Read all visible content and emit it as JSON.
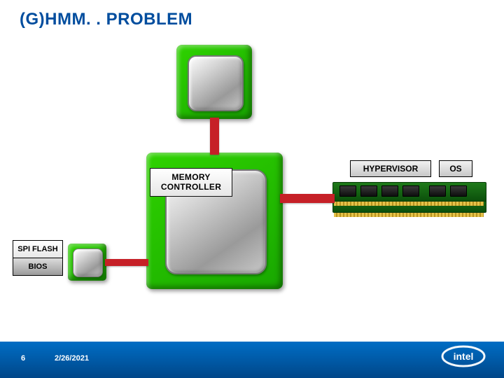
{
  "title": "(G)HMM. . PROBLEM",
  "labels": {
    "memory_controller_l1": "MEMORY",
    "memory_controller_l2": "CONTROLLER",
    "spi_flash": "SPI FLASH",
    "bios": "BIOS",
    "hypervisor": "HYPERVISOR",
    "os": "OS"
  },
  "footer": {
    "slide_number": "6",
    "date": "2/26/2021",
    "logo_text": "intel"
  },
  "diagram": {
    "nodes": [
      {
        "id": "cpu-small",
        "role": "processor-small"
      },
      {
        "id": "chipset",
        "role": "chipset-large",
        "attached_label": "memory-controller"
      },
      {
        "id": "spi-chip",
        "role": "spi-flash-chip"
      },
      {
        "id": "ram-module-1",
        "role": "dimm"
      },
      {
        "id": "ram-module-2",
        "role": "dimm"
      }
    ],
    "edges": [
      {
        "from": "cpu-small",
        "to": "chipset",
        "kind": "bus",
        "color": "#c62027"
      },
      {
        "from": "chipset",
        "to": "ram-module-1",
        "kind": "bus",
        "color": "#c62027"
      },
      {
        "from": "spi-chip",
        "to": "chipset",
        "kind": "bus",
        "color": "#c62027"
      }
    ],
    "ram_labels": [
      "hypervisor",
      "os"
    ]
  },
  "colors": {
    "title": "#004d9e",
    "bus": "#c62027",
    "chip_green_light": "#2fd300",
    "chip_green_dark": "#18a700",
    "footer_gradient_top": "#006dc4",
    "footer_gradient_bottom": "#004688"
  }
}
